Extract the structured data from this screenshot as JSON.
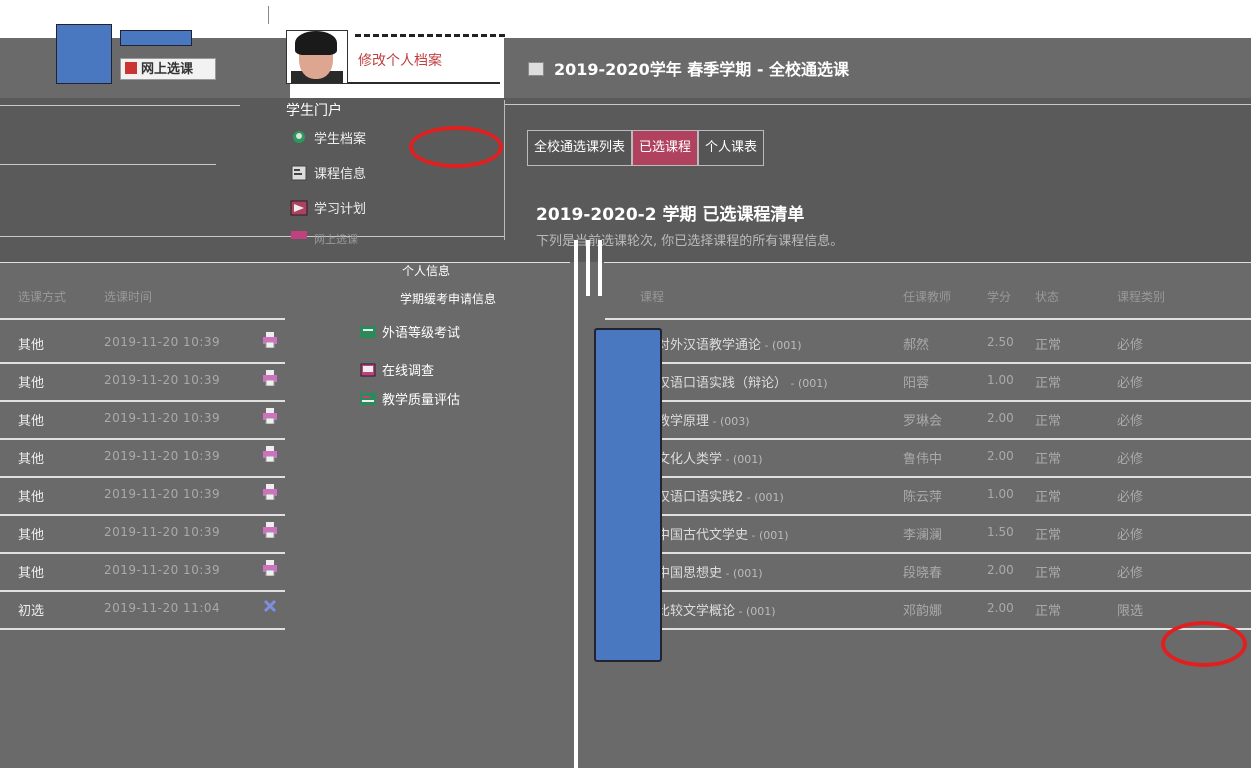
{
  "header": {
    "online_course_label": "网上选课",
    "profile_link": "修改个人档案",
    "page_title": "2019-2020学年 春季学期 - 全校通选课"
  },
  "portal": {
    "title": "学生门户",
    "menu": [
      {
        "label": "学生档案",
        "icon": "student-icon"
      },
      {
        "label": "课程信息",
        "icon": "course-info-icon"
      },
      {
        "label": "学习计划",
        "icon": "plan-icon"
      },
      {
        "label": "网上选课",
        "icon": "select-icon"
      }
    ],
    "personal_info": "个人信息",
    "leave_info": "学期缓考申请信息",
    "sub_menu": [
      {
        "label": "外语等级考试",
        "icon": "exam-icon"
      },
      {
        "label": "在线调查",
        "icon": "survey-icon"
      },
      {
        "label": "教学质量评估",
        "icon": "evaluation-icon"
      }
    ]
  },
  "tabs": [
    {
      "label": "全校通选课列表",
      "active": false
    },
    {
      "label": "已选课程",
      "active": true
    },
    {
      "label": "个人课表",
      "active": false
    }
  ],
  "section": {
    "title": "2019-2020-2 学期 已选课程清单",
    "note": "下列是当前选课轮次, 你已选择课程的所有课程信息。"
  },
  "left_table": {
    "headers": [
      "选课方式",
      "选课时间"
    ],
    "rows": [
      {
        "type": "其他",
        "time": "2019-11-20 10:39",
        "icon": "printer-icon"
      },
      {
        "type": "其他",
        "time": "2019-11-20 10:39",
        "icon": "printer-icon"
      },
      {
        "type": "其他",
        "time": "2019-11-20 10:39",
        "icon": "printer-icon"
      },
      {
        "type": "其他",
        "time": "2019-11-20 10:39",
        "icon": "printer-icon"
      },
      {
        "type": "其他",
        "time": "2019-11-20 10:39",
        "icon": "printer-icon"
      },
      {
        "type": "其他",
        "time": "2019-11-20 10:39",
        "icon": "printer-icon"
      },
      {
        "type": "其他",
        "time": "2019-11-20 10:39",
        "icon": "printer-icon"
      },
      {
        "type": "初选",
        "time": "2019-11-20 11:04",
        "icon": "delete-icon"
      }
    ]
  },
  "right_table": {
    "headers": [
      "课程",
      "任课教师",
      "学分",
      "状态",
      "课程类别"
    ],
    "rows": [
      {
        "name": "对外汉语教学通论",
        "code": " - (001)",
        "teacher": "郝然",
        "credit": "2.50",
        "status": "正常",
        "category": "必修"
      },
      {
        "name": "汉语口语实践（辩论）",
        "code": " - (001)",
        "teacher": "阳蓉",
        "credit": "1.00",
        "status": "正常",
        "category": "必修"
      },
      {
        "name": "教学原理",
        "code": " - (003)",
        "teacher": "罗琳会",
        "credit": "2.00",
        "status": "正常",
        "category": "必修"
      },
      {
        "name": "文化人类学",
        "code": " - (001)",
        "teacher": "鲁伟中",
        "credit": "2.00",
        "status": "正常",
        "category": "必修"
      },
      {
        "name": "汉语口语实践2",
        "code": " - (001)",
        "teacher": "陈云萍",
        "credit": "1.00",
        "status": "正常",
        "category": "必修"
      },
      {
        "name": "中国古代文学史",
        "code": " - (001)",
        "teacher": "李澜澜",
        "credit": "1.50",
        "status": "正常",
        "category": "必修"
      },
      {
        "name": "中国思想史",
        "code": " - (001)",
        "teacher": "段晓春",
        "credit": "2.00",
        "status": "正常",
        "category": "必修"
      },
      {
        "name": "比较文学概论",
        "code": " - (001)",
        "teacher": "邓韵娜",
        "credit": "2.00",
        "status": "正常",
        "category": "限选"
      }
    ]
  }
}
